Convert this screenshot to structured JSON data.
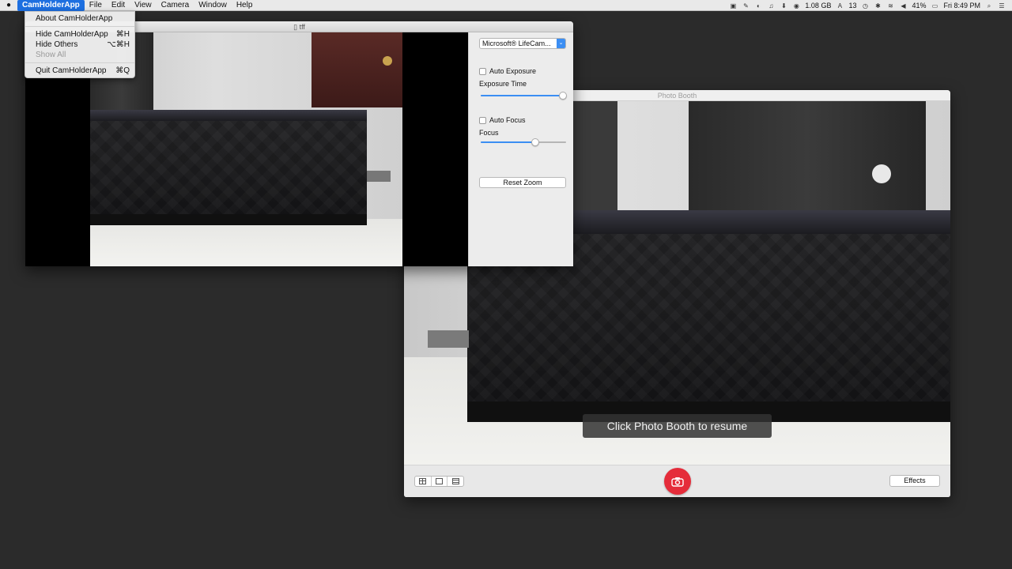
{
  "menubar": {
    "app_name": "CamHolderApp",
    "items": [
      "File",
      "Edit",
      "View",
      "Camera",
      "Window",
      "Help"
    ],
    "status": {
      "memory": "1.08 GB",
      "count": "13",
      "battery": "41%",
      "clock": "Fri 8:49 PM"
    }
  },
  "app_menu": {
    "about": "About CamHolderApp",
    "hide": "Hide CamHolderApp",
    "hide_shortcut": "⌘H",
    "hide_others": "Hide Others",
    "hide_others_shortcut": "⌥⌘H",
    "show_all": "Show All",
    "quit": "Quit CamHolderApp",
    "quit_shortcut": "⌘Q"
  },
  "cam_window": {
    "title": "tff",
    "camera_select": "Microsoft® LifeCam...",
    "auto_exposure_label": "Auto Exposure",
    "auto_exposure_checked": false,
    "exposure_time_label": "Exposure Time",
    "exposure_time_value": 0.96,
    "auto_focus_label": "Auto Focus",
    "auto_focus_checked": false,
    "focus_label": "Focus",
    "focus_value": 0.64,
    "reset_zoom_label": "Reset Zoom"
  },
  "photobooth": {
    "title": "Photo Booth",
    "resume_message": "Click Photo Booth to resume",
    "effects_label": "Effects"
  },
  "colors": {
    "accent": "#3b8ef3",
    "shutter": "#e52c3a",
    "desktop": "#2b2b2b"
  }
}
